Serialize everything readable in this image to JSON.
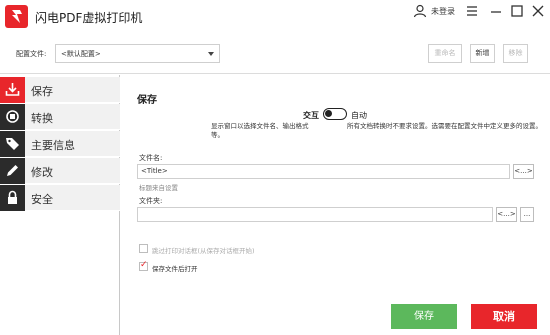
{
  "titlebar": {
    "app_title": "闪电PDF虚拟打印机",
    "login_label": "未登录"
  },
  "config": {
    "label": "配置文件:",
    "selected": "<默认配置>",
    "rename_label": "重命名",
    "new_label": "新增",
    "delete_label": "移除"
  },
  "sidebar": {
    "items": [
      {
        "label": "保存",
        "icon": "download-icon"
      },
      {
        "label": "转换",
        "icon": "convert-icon"
      },
      {
        "label": "主要信息",
        "icon": "tag-icon"
      },
      {
        "label": "修改",
        "icon": "pencil-icon"
      },
      {
        "label": "安全",
        "icon": "lock-icon"
      }
    ]
  },
  "main": {
    "section_title": "保存",
    "mode_interactive": "交互",
    "mode_auto": "自动",
    "desc_interactive": "显示窗口以选择文件名、输出格式等。",
    "desc_auto": "所有文档转换时不要求设置。选需要在配置文件中定义更多的设置。",
    "filename_label": "文件名:",
    "filename_value": "<Title>",
    "filename_token_button": "<...>",
    "filename_hint": "标题来自设置",
    "folder_label": "文件夹:",
    "folder_value": "",
    "folder_token_button": "<...>",
    "folder_browse_button": "...",
    "skip_print_dialog_label": "跳过打印对话框(从保存对话框开始)",
    "skip_print_dialog_checked": false,
    "open_after_save_label": "保存文件后打开",
    "open_after_save_checked": true
  },
  "footer": {
    "save_label": "保存",
    "cancel_label": "取消"
  },
  "colors": {
    "accent_red": "#e8262b",
    "save_green": "#5cb85c",
    "nav_dark": "#2b2b2b"
  }
}
